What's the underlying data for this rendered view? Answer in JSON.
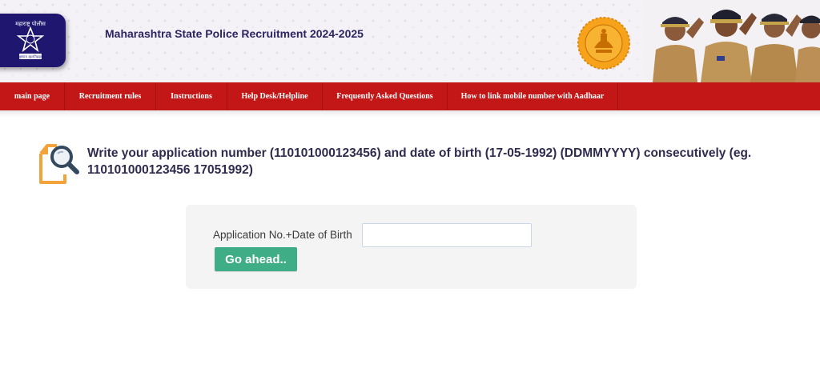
{
  "header": {
    "title": "Maharashtra State Police Recruitment 2024-2025",
    "logo": {
      "icon": "maharashtra-police-badge",
      "text_top": "महाराष्ट्र पोलीस",
      "text_bottom": "सद्रक्षणाय खलनिग्रहणाय"
    },
    "emblem_icon": "maharashtra-state-seal",
    "banner_image": "police-officers-saluting"
  },
  "nav": {
    "items": [
      {
        "label": "main page"
      },
      {
        "label": "Recruitment rules"
      },
      {
        "label": "Instructions"
      },
      {
        "label": "Help Desk/Helpline"
      },
      {
        "label": "Frequently Asked Questions"
      },
      {
        "label": "How to link mobile number with Aadhaar"
      }
    ]
  },
  "instruction": {
    "icon": "document-search-icon",
    "text": "Write your application number (110101000123456) and date of birth (17-05-1992) (DDMMYYYY) consecutively (eg. 110101000123456 17051992)"
  },
  "form": {
    "label": "Application No.+Date of Birth",
    "input_value": "",
    "input_placeholder": "",
    "submit_label": "Go ahead.."
  },
  "colors": {
    "nav_bg": "#c31616",
    "title_color": "#2b2563",
    "button_bg": "#3fae86",
    "logo_bg": "#1f1670"
  }
}
